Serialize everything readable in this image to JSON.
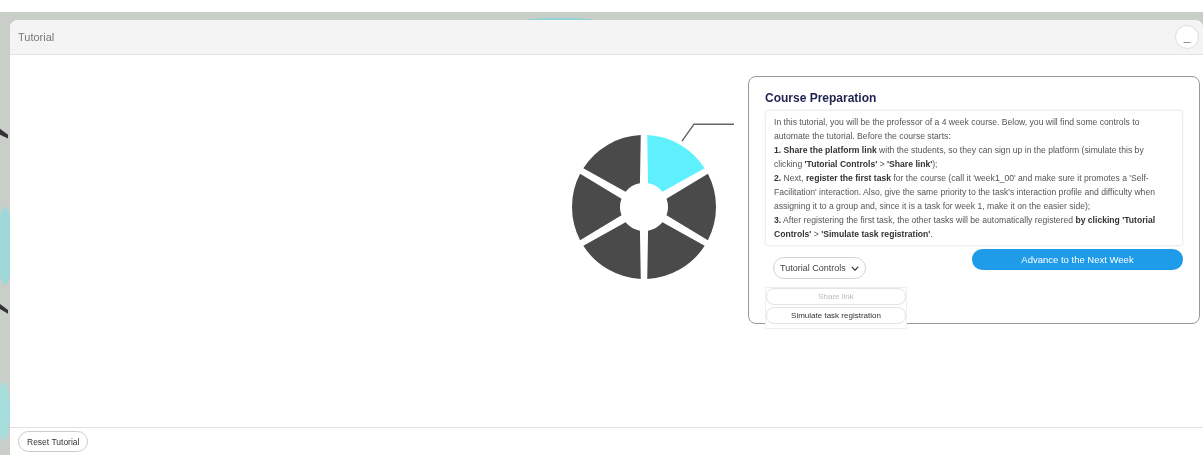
{
  "window": {
    "title": "Tutorial",
    "minimize_label": "_"
  },
  "wheel": {
    "segments": [
      {
        "active": true
      },
      {
        "active": false
      },
      {
        "active": false
      },
      {
        "active": false
      },
      {
        "active": false
      },
      {
        "active": false
      }
    ]
  },
  "card": {
    "title": "Course Preparation",
    "paragraphs": [
      "In this tutorial, you will be the professor of a 4 week course. Below, you will find some controls to automate the tutorial. Before the course starts:",
      "**1. Share the platform link** with the students, so they can sign up in the platform (simulate this by clicking **'Tutorial Controls'** > **'Share link'**);",
      "**2.** Next, **register the first task** for the course (call it 'week1_00' and make sure it promotes a 'Self-Facilitation' interaction. Also, give the same priority to the task's interaction profile and difficulty when assigning it to a group and, since it is a task for week 1, make it on the easier side);",
      "**3.** After registering the first task, the other tasks will be automatically registered **by clicking 'Tutorial Controls'** > **'Simulate task registration'**."
    ],
    "controls_label": "Tutorial Controls",
    "expanded": true,
    "menu": [
      {
        "label": "Share link",
        "disabled": true
      },
      {
        "label": "Simulate task registration",
        "disabled": false
      }
    ],
    "advance_button": "Advance to the Next Week"
  },
  "footer": {
    "reset_button": "Reset Tutorial"
  }
}
